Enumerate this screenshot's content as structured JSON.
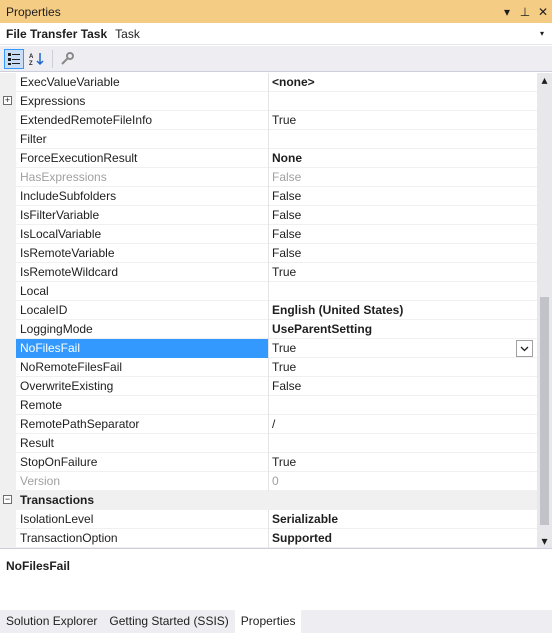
{
  "window": {
    "title": "Properties",
    "buttons": {
      "dropdown": "▾",
      "pin": "⊥",
      "close": "✕"
    }
  },
  "object": {
    "name": "File Transfer Task",
    "type": "Task",
    "dropdown": "▾"
  },
  "colors": {
    "titlebar": "#f5cc84",
    "selection": "#3399ff",
    "category_bg": "#f0f0f0"
  },
  "toolbar": {
    "buttons": [
      {
        "icon": "categorized-icon",
        "active": true
      },
      {
        "icon": "alphabetical-icon",
        "active": false
      },
      {
        "icon": "property-pages-icon",
        "active": false
      }
    ]
  },
  "properties": [
    {
      "name": "ExecValueVariable",
      "value": "<none>",
      "bold": true
    },
    {
      "name": "Expressions",
      "value": "",
      "expander": "+"
    },
    {
      "name": "ExtendedRemoteFileInfo",
      "value": "True"
    },
    {
      "name": "Filter",
      "value": ""
    },
    {
      "name": "ForceExecutionResult",
      "value": "None",
      "bold": true
    },
    {
      "name": "HasExpressions",
      "value": "False",
      "disabled": true
    },
    {
      "name": "IncludeSubfolders",
      "value": "False"
    },
    {
      "name": "IsFilterVariable",
      "value": "False"
    },
    {
      "name": "IsLocalVariable",
      "value": "False"
    },
    {
      "name": "IsRemoteVariable",
      "value": "False"
    },
    {
      "name": "IsRemoteWildcard",
      "value": "True"
    },
    {
      "name": "Local",
      "value": ""
    },
    {
      "name": "LocaleID",
      "value": "English (United States)",
      "bold": true
    },
    {
      "name": "LoggingMode",
      "value": "UseParentSetting",
      "bold": true
    },
    {
      "name": "NoFilesFail",
      "value": "True",
      "selected": true
    },
    {
      "name": "NoRemoteFilesFail",
      "value": "True"
    },
    {
      "name": "OverwriteExisting",
      "value": "False"
    },
    {
      "name": "Remote",
      "value": ""
    },
    {
      "name": "RemotePathSeparator",
      "value": "/"
    },
    {
      "name": "Result",
      "value": ""
    },
    {
      "name": "StopOnFailure",
      "value": "True"
    },
    {
      "name": "Version",
      "value": "0",
      "disabled": true
    },
    {
      "name": "Transactions",
      "value": "",
      "category": true,
      "expander": "−"
    },
    {
      "name": "IsolationLevel",
      "value": "Serializable",
      "bold": true
    },
    {
      "name": "TransactionOption",
      "value": "Supported",
      "bold": true
    }
  ],
  "scrollbar": {
    "up": "▴",
    "down": "▾",
    "thumb_start": 0.47,
    "thumb_end": 0.98
  },
  "description": {
    "name": "NoFilesFail"
  },
  "tabs": [
    {
      "label": "Solution Explorer",
      "active": false
    },
    {
      "label": "Getting Started (SSIS)",
      "active": false
    },
    {
      "label": "Properties",
      "active": true
    }
  ]
}
